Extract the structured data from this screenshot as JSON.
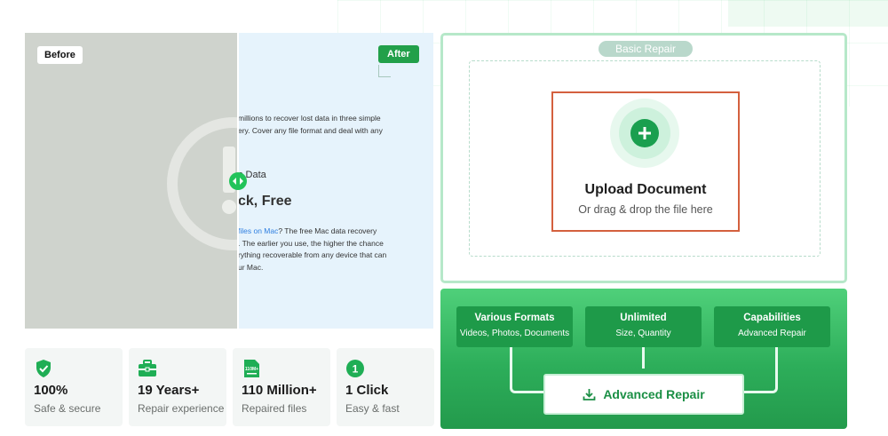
{
  "compare": {
    "before_label": "Before",
    "after_label": "After",
    "after_text": {
      "para1_line1": "millions to recover lost data in three simple",
      "para1_line2": "ery. Cover any file format and deal with any",
      "heading_small": "c Data",
      "heading_large": "ck, Free",
      "para2_link": "files on Mac",
      "para2_line1_rest": "? The free Mac data recovery",
      "para2_line2": ". The earlier you use, the higher the chance",
      "para2_line3": "rything recoverable from any device that can",
      "para2_line4": "ur Mac."
    }
  },
  "stats": [
    {
      "icon": "shield-check-icon",
      "value": "100%",
      "label": "Safe & secure"
    },
    {
      "icon": "toolbox-icon",
      "value": "19 Years+",
      "label": "Repair experience"
    },
    {
      "icon": "file-count-icon",
      "icon_text": "110M+",
      "value": "110 Million+",
      "label": "Repaired files"
    },
    {
      "icon": "number-one-icon",
      "icon_text": "1",
      "value": "1 Click",
      "label": "Easy & fast"
    }
  ],
  "basic_repair": {
    "label": "Basic Repair",
    "upload_title": "Upload Document",
    "upload_subtitle": "Or drag & drop the file here"
  },
  "advanced_repair": {
    "features": [
      {
        "title": "Various Formats",
        "subtitle": "Videos, Photos, Documents"
      },
      {
        "title": "Unlimited",
        "subtitle": "Size, Quantity"
      },
      {
        "title": "Capabilities",
        "subtitle": "Advanced Repair"
      }
    ],
    "button_label": "Advanced Repair"
  },
  "colors": {
    "brand_green": "#22a04a",
    "upload_border": "#d4603e",
    "link_blue": "#2f7fe0"
  }
}
